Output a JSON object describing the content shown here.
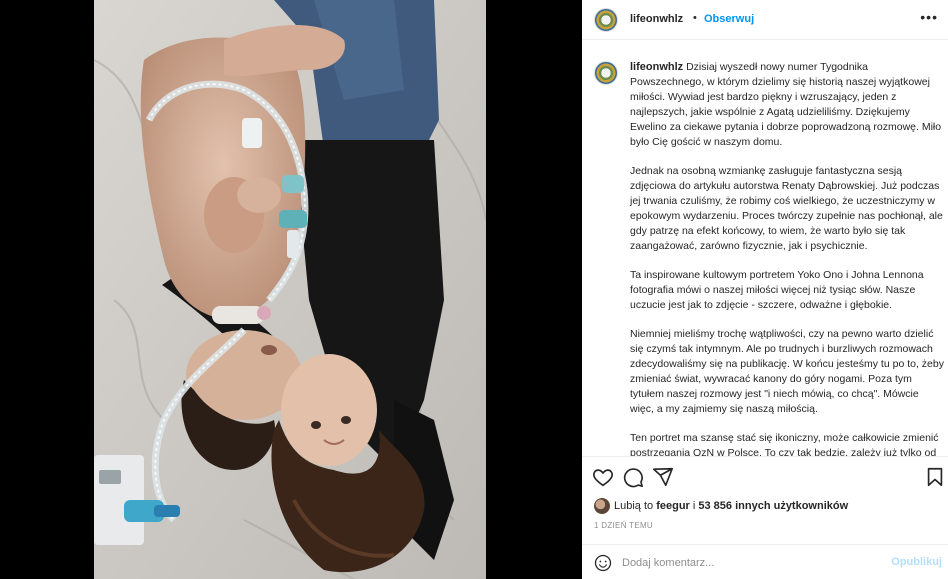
{
  "post": {
    "username": "lifeonwhlz",
    "dot": "•",
    "follow_label": "Obserwuj",
    "more_label": "•••"
  },
  "caption": {
    "username": "lifeonwhlz",
    "paragraphs": [
      "Dzisiaj wyszedł nowy numer Tygodnika Powszechnego, w którym dzielimy się historią naszej wyjątkowej miłości. Wywiad jest bardzo piękny i wzruszający, jeden z najlepszych, jakie wspólnie z Agatą udzieliliśmy. Dziękujemy Ewelino za ciekawe pytania i dobrze poprowadzoną rozmowę. Miło było Cię gościć w naszym domu.",
      "Jednak na osobną wzmiankę zasługuje fantastyczna sesją zdjęciowa do artykułu autorstwa Renaty Dąbrowskiej. Już podczas jej trwania czuliśmy, że robimy coś wielkiego, że uczestniczymy w epokowym wydarzeniu. Proces twórczy zupełnie nas pochłonął, ale gdy patrzę na efekt końcowy, to wiem, że warto było się tak zaangażować, zarówno fizycznie, jak i psychicznie.",
      "Ta inspirowane kultowym portretem Yoko Ono i Johna Lennona fotografia mówi o naszej miłości więcej niż tysiąc słów. Nasze uczucie jest jak to zdjęcie - szczere, odważne i głębokie.",
      "Niemniej mieliśmy trochę wątpliwości, czy na pewno warto dzielić się czymś tak intymnym. Ale po trudnych i burzliwych rozmowach zdecydowaliśmy się na publikację. W końcu jesteśmy tu po to, żeby zmieniać świat, wywracać kanony do góry nogami. Poza tym tytułem naszej rozmowy jest \"i niech mówią, co chcą\". Mówcie więc, a my zajmiemy się naszą miłością.",
      "Ten portret ma szansę stać się ikoniczny, może całkowicie zmienić postrzegania OzN w Polsce. To czy tak będzie, zależy już tylko od was."
    ]
  },
  "icons": {
    "like": "heart-icon",
    "comment": "comment-icon",
    "share": "share-icon",
    "save": "bookmark-icon",
    "emoji": "emoji-icon"
  },
  "likes": {
    "prefix": "Lubią to ",
    "first_user": "feegur",
    "middle": " i ",
    "others": "53 856 innych użytkowników"
  },
  "timestamp": "1 DZIEŃ TEMU",
  "comment_box": {
    "placeholder": "Dodaj komentarz...",
    "post_label": "Opublikuj"
  },
  "colors": {
    "accent": "#0095f6",
    "post_disabled": "#b2dffc",
    "muted": "#8e8e8e"
  }
}
